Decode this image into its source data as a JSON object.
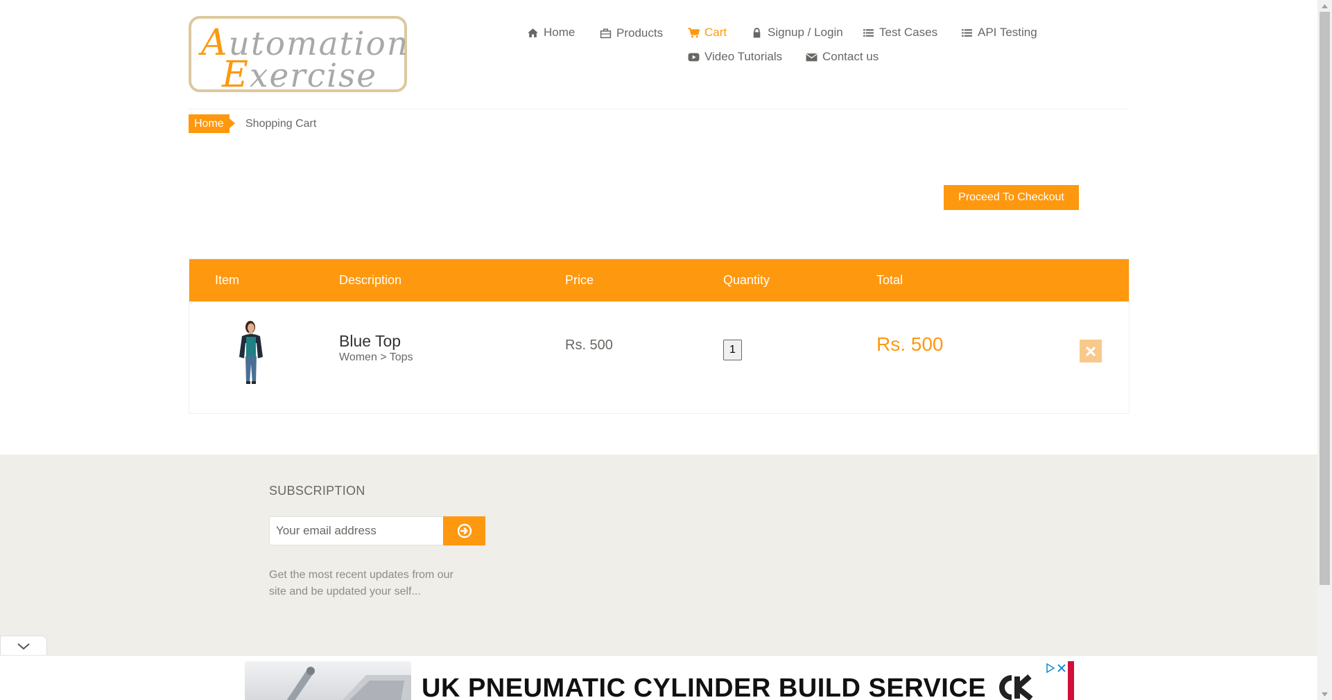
{
  "header": {
    "logo_text": "Automation Exercise",
    "nav": [
      {
        "label": "Home",
        "icon": "home-icon"
      },
      {
        "label": "Products",
        "icon": "briefcase-icon"
      },
      {
        "label": "Cart",
        "icon": "cart-icon",
        "active": true
      },
      {
        "label": "Signup / Login",
        "icon": "lock-icon"
      },
      {
        "label": "Test Cases",
        "icon": "list-icon"
      },
      {
        "label": "API Testing",
        "icon": "list-icon"
      },
      {
        "label": "Video Tutorials",
        "icon": "youtube-play-icon"
      },
      {
        "label": "Contact us",
        "icon": "envelope-icon"
      }
    ]
  },
  "breadcrumb": {
    "home": "Home",
    "current": "Shopping Cart"
  },
  "checkout": {
    "button_label": "Proceed To Checkout"
  },
  "cart": {
    "columns": [
      "Item",
      "Description",
      "Price",
      "Quantity",
      "Total"
    ],
    "items": [
      {
        "name": "Blue Top",
        "category": "Women > Tops",
        "price": "Rs. 500",
        "quantity": "1",
        "total": "Rs. 500"
      }
    ]
  },
  "footer": {
    "subscription_title": "SUBSCRIPTION",
    "email_placeholder": "Your email address",
    "subscription_text": "Get the most recent updates from our site and be updated your self..."
  },
  "ad": {
    "headline": "UK PNEUMATIC CYLINDER BUILD SERVICE"
  },
  "colors": {
    "accent": "#fe980f",
    "footer_bg": "#efeee9",
    "text": "#696763"
  }
}
